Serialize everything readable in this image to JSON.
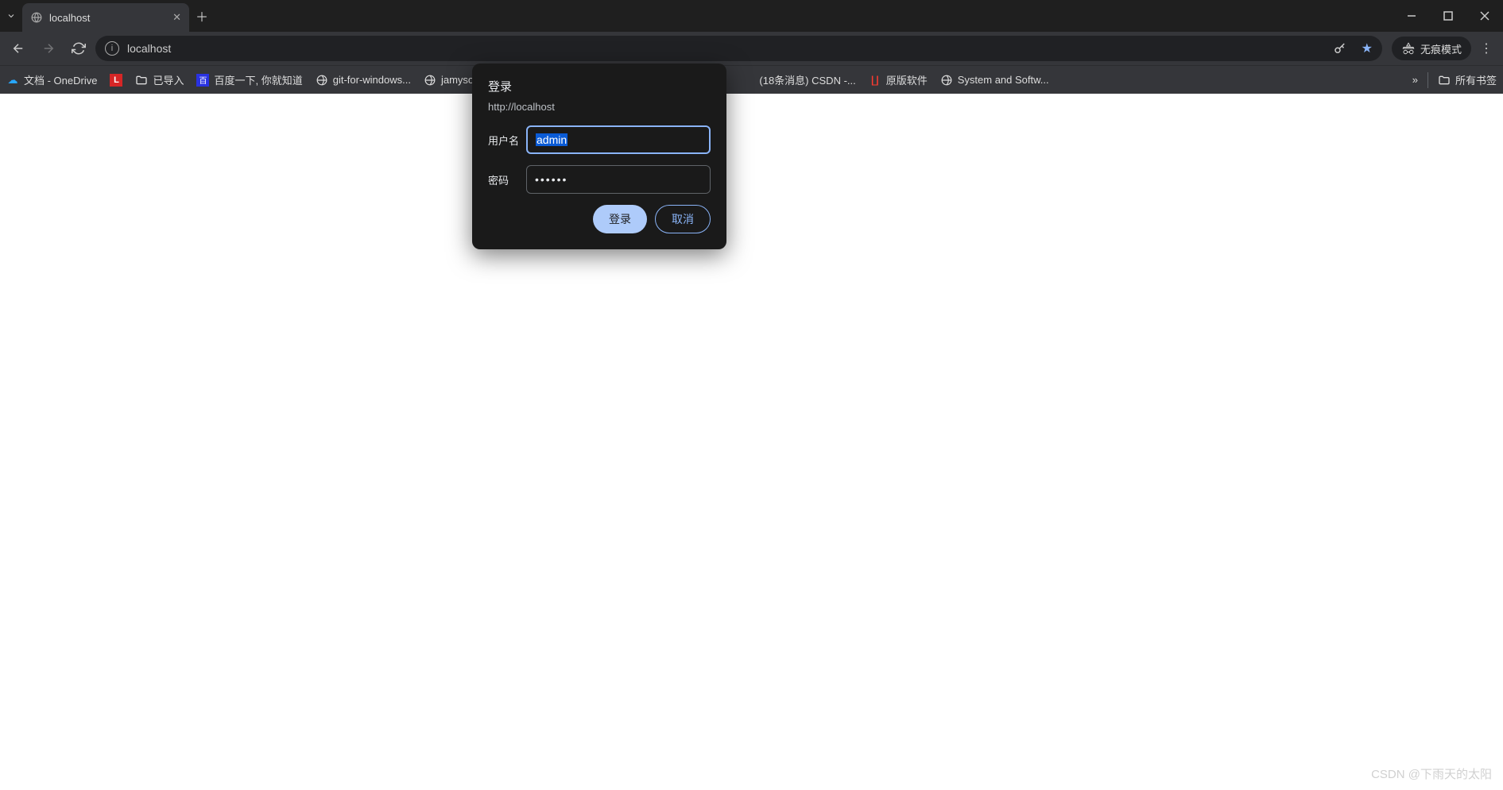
{
  "tab": {
    "title": "localhost"
  },
  "address": {
    "url": "localhost"
  },
  "incognito_label": "无痕模式",
  "bookmarks": {
    "items": [
      {
        "label": "文档 - OneDrive",
        "icon": "onedrive"
      },
      {
        "label": "",
        "icon": "red-l"
      },
      {
        "label": "已导入",
        "icon": "folder"
      },
      {
        "label": "百度一下, 你就知道",
        "icon": "baidu"
      },
      {
        "label": "git-for-windows...",
        "icon": "globe"
      },
      {
        "label": "jamyson",
        "icon": "globe"
      },
      {
        "label": "(18条消息) CSDN -...",
        "icon": "none"
      },
      {
        "label": "原版软件",
        "icon": "itell"
      },
      {
        "label": "System and Softw...",
        "icon": "globe"
      }
    ],
    "all_bookmarks": "所有书签"
  },
  "dialog": {
    "title": "登录",
    "origin": "http://localhost",
    "username_label": "用户名",
    "username_value": "admin",
    "password_label": "密码",
    "password_value": "••••••",
    "signin_label": "登录",
    "cancel_label": "取消"
  },
  "watermark": "CSDN @下雨天的太阳"
}
